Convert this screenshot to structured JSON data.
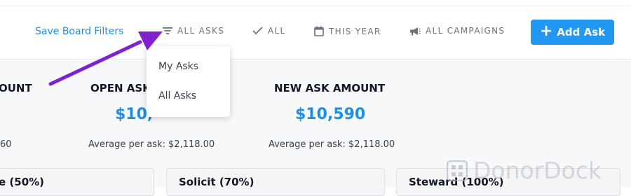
{
  "toolbar": {
    "save_filters_label": "Save Board Filters",
    "filters": [
      {
        "label": "ALL ASKS",
        "icon": "filter-lines-icon"
      },
      {
        "label": "ALL",
        "icon": "check-icon"
      },
      {
        "label": "THIS YEAR",
        "icon": "calendar-icon"
      },
      {
        "label": "ALL CAMPAIGNS",
        "icon": "megaphone-icon"
      }
    ],
    "add_button_label": "Add Ask",
    "add_button_icon": "plus-icon"
  },
  "dropdown": {
    "items": [
      "My Asks",
      "All Asks"
    ]
  },
  "metrics": [
    {
      "title": "OUNT",
      "value": "",
      "sub": "60"
    },
    {
      "title": "OPEN ASK",
      "value": "$10,",
      "sub": "Average per ask: $2,118.00"
    },
    {
      "title": "NEW ASK AMOUNT",
      "value": "$10,590",
      "sub": "Average per ask: $2,118.00"
    }
  ],
  "stages": [
    {
      "label": "e (50%)"
    },
    {
      "label": "Solicit (70%)"
    },
    {
      "label": "Steward (100%)"
    }
  ],
  "watermark": {
    "text": "DonorDock",
    "icon": "dock-logo-icon"
  },
  "colors": {
    "accent": "#2196f3",
    "link": "#1f8ee6",
    "annotation_arrow": "#7e22ce"
  }
}
